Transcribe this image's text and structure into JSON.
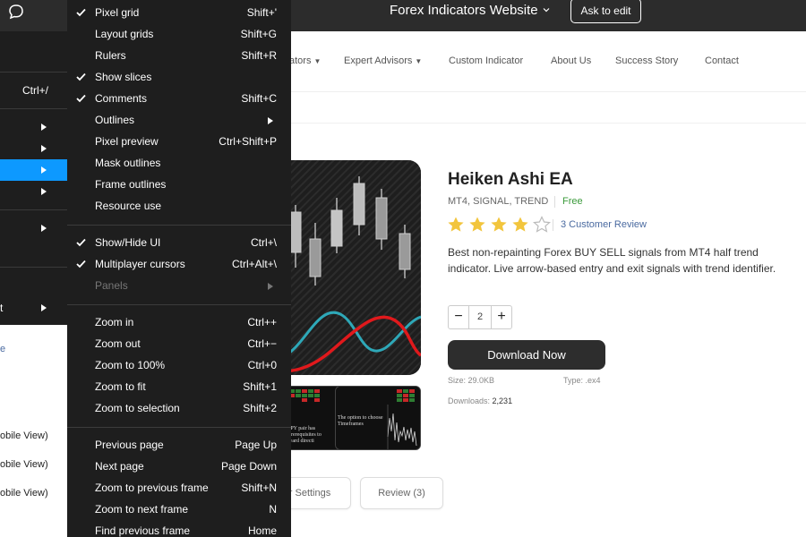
{
  "topbar": {
    "site_title": "Forex Indicators Website",
    "ask_button": "Ask to edit"
  },
  "nav": {
    "items": [
      {
        "label": "ators",
        "has_caret": true
      },
      {
        "label": "Expert Advisors",
        "has_caret": true
      },
      {
        "label": "Custom Indicator",
        "has_caret": false
      },
      {
        "label": "About Us",
        "has_caret": false
      },
      {
        "label": "Success Story",
        "has_caret": false
      },
      {
        "label": "Contact",
        "has_caret": false
      }
    ]
  },
  "product": {
    "title": "Heiken Ashi EA",
    "tags": "MT4, SIGNAL, TREND",
    "price": "Free",
    "rating": 4,
    "rating_max": 5,
    "review_link": "3 Customer Review",
    "description": "Best non-repainting Forex BUY SELL signals from MT4 half trend indicator. Live arrow-based entry and exit signals with trend identifier.",
    "quantity": "2",
    "minus": "−",
    "plus": "+",
    "download_label": "Download Now",
    "size": "Size: 29.0KB",
    "type": "Type: .ex4",
    "downloads_label": "Downloads:",
    "downloads_value": "2,231",
    "thumb1_text": "JPY pair has prerequisites to ward directi",
    "thumb2_text": "The option to choose Timeframes",
    "tabs": [
      "r Settings",
      "Review (3)"
    ]
  },
  "left_panel": {
    "shortcut": "Ctrl+/",
    "partial_item": "t",
    "page_link": "e",
    "page_items": [
      "obile View)",
      "obile View)",
      "obile View)"
    ]
  },
  "menu": {
    "groups": [
      [
        {
          "label": "Pixel grid",
          "shortcut": "Shift+'",
          "checked": true
        },
        {
          "label": "Layout grids",
          "shortcut": "Shift+G",
          "checked": false
        },
        {
          "label": "Rulers",
          "shortcut": "Shift+R",
          "checked": false
        },
        {
          "label": "Show slices",
          "shortcut": "",
          "checked": true
        },
        {
          "label": "Comments",
          "shortcut": "Shift+C",
          "checked": true
        },
        {
          "label": "Outlines",
          "shortcut": "",
          "checked": false,
          "submenu": true
        },
        {
          "label": "Pixel preview",
          "shortcut": "Ctrl+Shift+P",
          "checked": false
        },
        {
          "label": "Mask outlines",
          "shortcut": "",
          "checked": false
        },
        {
          "label": "Frame outlines",
          "shortcut": "",
          "checked": false
        },
        {
          "label": "Resource use",
          "shortcut": "",
          "checked": false
        }
      ],
      [
        {
          "label": "Show/Hide UI",
          "shortcut": "Ctrl+\\",
          "checked": true
        },
        {
          "label": "Multiplayer cursors",
          "shortcut": "Ctrl+Alt+\\",
          "checked": true
        },
        {
          "label": "Panels",
          "shortcut": "",
          "checked": false,
          "submenu": true,
          "disabled": true
        }
      ],
      [
        {
          "label": "Zoom in",
          "shortcut": "Ctrl++",
          "checked": false
        },
        {
          "label": "Zoom out",
          "shortcut": "Ctrl+−",
          "checked": false
        },
        {
          "label": "Zoom to 100%",
          "shortcut": "Ctrl+0",
          "checked": false
        },
        {
          "label": "Zoom to fit",
          "shortcut": "Shift+1",
          "checked": false
        },
        {
          "label": "Zoom to selection",
          "shortcut": "Shift+2",
          "checked": false
        }
      ],
      [
        {
          "label": "Previous page",
          "shortcut": "Page Up",
          "checked": false
        },
        {
          "label": "Next page",
          "shortcut": "Page Down",
          "checked": false
        },
        {
          "label": "Zoom to previous frame",
          "shortcut": "Shift+N",
          "checked": false
        },
        {
          "label": "Zoom to next frame",
          "shortcut": "N",
          "checked": false
        },
        {
          "label": "Find previous frame",
          "shortcut": "Home",
          "checked": false
        }
      ]
    ]
  },
  "colors": {
    "menu_bg": "#1e1e1e",
    "accent": "#0d99ff",
    "price_green": "#3a9a3a",
    "star": "#f2c53d"
  }
}
